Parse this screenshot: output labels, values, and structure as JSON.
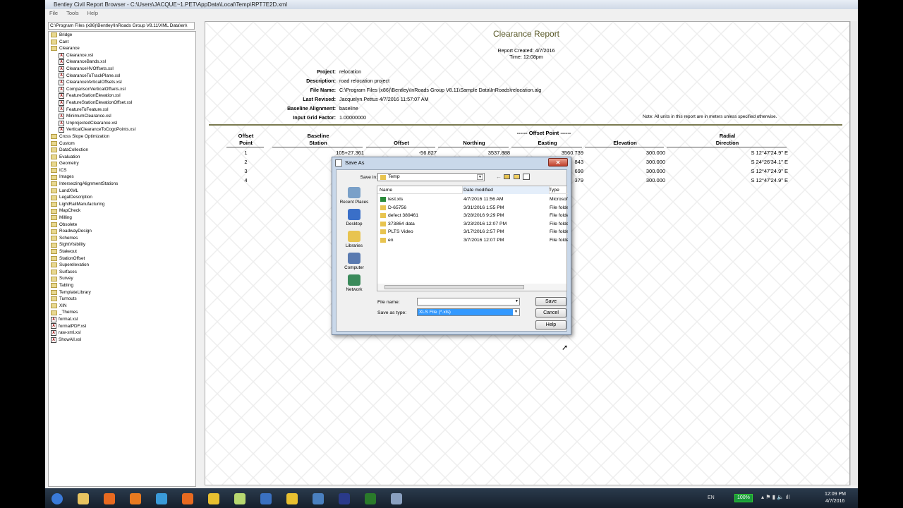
{
  "window": {
    "title": "Bentley Civil Report Browser - C:\\Users\\JACQUE~1.PET\\AppData\\Local\\Temp\\RPT7E2D.xml",
    "menu": [
      "File",
      "Tools",
      "Help"
    ]
  },
  "sidebar": {
    "path": "C:\\Program Files (x86)\\Bentley\\InRoads Group V8.11\\XML Data\\en\\",
    "items": [
      {
        "label": "Bridge",
        "type": "folder",
        "level": 0
      },
      {
        "label": "Cant",
        "type": "folder",
        "level": 0
      },
      {
        "label": "Clearance",
        "type": "folder-open",
        "level": 0
      },
      {
        "label": "Clearance.xsl",
        "type": "xsl",
        "level": 1
      },
      {
        "label": "ClearanceBands.xsl",
        "type": "xsl",
        "level": 1
      },
      {
        "label": "ClearanceHVOffsets.xsl",
        "type": "xsl",
        "level": 1
      },
      {
        "label": "ClearanceToTrackPlane.xsl",
        "type": "xsl",
        "level": 1
      },
      {
        "label": "ClearanceVerticalOffsets.xsl",
        "type": "xsl",
        "level": 1
      },
      {
        "label": "ComparisonVerticalOffsets.xsl",
        "type": "xsl",
        "level": 1
      },
      {
        "label": "FeatureStationElevation.xsl",
        "type": "xsl",
        "level": 1
      },
      {
        "label": "FeatureStationElevationOffset.xsl",
        "type": "xsl",
        "level": 1
      },
      {
        "label": "FeatureToFeature.xsl",
        "type": "xsl",
        "level": 1
      },
      {
        "label": "MinimumClearance.xsl",
        "type": "xsl",
        "level": 1
      },
      {
        "label": "UnprojectedClearance.xsl",
        "type": "xsl",
        "level": 1
      },
      {
        "label": "VerticalClearanceToCogoPoints.xsl",
        "type": "xsl",
        "level": 1
      },
      {
        "label": "Cross Slope Optimization",
        "type": "folder",
        "level": 0
      },
      {
        "label": "Custom",
        "type": "folder",
        "level": 0
      },
      {
        "label": "DataCollection",
        "type": "folder",
        "level": 0
      },
      {
        "label": "Evaluation",
        "type": "folder",
        "level": 0
      },
      {
        "label": "Geometry",
        "type": "folder",
        "level": 0
      },
      {
        "label": "ICS",
        "type": "folder",
        "level": 0
      },
      {
        "label": "Images",
        "type": "folder",
        "level": 0
      },
      {
        "label": "IntersectingAlignmentStations",
        "type": "folder",
        "level": 0
      },
      {
        "label": "LandXML",
        "type": "folder",
        "level": 0
      },
      {
        "label": "LegalDescription",
        "type": "folder",
        "level": 0
      },
      {
        "label": "LightRailManufacturing",
        "type": "folder",
        "level": 0
      },
      {
        "label": "MapCheck",
        "type": "folder",
        "level": 0
      },
      {
        "label": "Milling",
        "type": "folder",
        "level": 0
      },
      {
        "label": "Obsolete",
        "type": "folder",
        "level": 0
      },
      {
        "label": "RoadwayDesign",
        "type": "folder",
        "level": 0
      },
      {
        "label": "Schemes",
        "type": "folder",
        "level": 0
      },
      {
        "label": "SightVisibility",
        "type": "folder",
        "level": 0
      },
      {
        "label": "Stakeout",
        "type": "folder",
        "level": 0
      },
      {
        "label": "StationOffset",
        "type": "folder",
        "level": 0
      },
      {
        "label": "Superelevation",
        "type": "folder",
        "level": 0
      },
      {
        "label": "Surfaces",
        "type": "folder",
        "level": 0
      },
      {
        "label": "Survey",
        "type": "folder",
        "level": 0
      },
      {
        "label": "Tabling",
        "type": "folder",
        "level": 0
      },
      {
        "label": "TemplateLibrary",
        "type": "folder",
        "level": 0
      },
      {
        "label": "Turnouts",
        "type": "folder",
        "level": 0
      },
      {
        "label": "XIN",
        "type": "folder",
        "level": 0
      },
      {
        "label": "_Themes",
        "type": "folder",
        "level": 0
      },
      {
        "label": "format.xsl",
        "type": "xsl",
        "level": 0
      },
      {
        "label": "formatPDF.xsl",
        "type": "xsl",
        "level": 0
      },
      {
        "label": "raw-xml.xsl",
        "type": "xsl",
        "level": 0
      },
      {
        "label": "ShowAll.xsl",
        "type": "xsl",
        "level": 0
      }
    ]
  },
  "report": {
    "title": "Clearance Report",
    "created": "Report Created:  4/7/2016",
    "time": "Time:  12:08pm",
    "fields": [
      {
        "label": "Project:",
        "value": "relocation"
      },
      {
        "label": "Description:",
        "value": "road relocation project"
      },
      {
        "label": "File Name:",
        "value": "C:\\Program Files (x86)\\Bentley\\InRoads Group V8.11\\Sample Data\\InRoads\\relocation.alg"
      },
      {
        "label": "Last Revised:",
        "value": "Jacquelyn.Pettus 4/7/2016 11:57:07 AM"
      },
      {
        "label": "Baseline Alignment:",
        "value": "baseline"
      },
      {
        "label": "Input Grid Factor:",
        "value": "1.00000000"
      }
    ],
    "note": "Note:  All units in this report are in meters unless specified otherwise.",
    "group_header": "------ Offset Point ------",
    "columns": [
      {
        "l1": "Offset",
        "l2": "Point"
      },
      {
        "l1": "Baseline",
        "l2": "Station"
      },
      {
        "l1": "",
        "l2": "Offset"
      },
      {
        "l1": "",
        "l2": "Northing"
      },
      {
        "l1": "",
        "l2": "Easting"
      },
      {
        "l1": "",
        "l2": "Elevation"
      },
      {
        "l1": "Radial",
        "l2": "Direction"
      }
    ],
    "rows": [
      [
        "1",
        "105+27.361",
        "-56.827",
        "3537.888",
        "3560.739",
        "300.000",
        "S 12°47'24.9\" E"
      ],
      [
        "2",
        "",
        "",
        "",
        "843",
        "300.000",
        "S 24°26'34.1\" E"
      ],
      [
        "3",
        "",
        "",
        "",
        "698",
        "300.000",
        "S 12°47'24.9\" E"
      ],
      [
        "4",
        "",
        "",
        "",
        "379",
        "300.000",
        "S 12°47'24.9\" E"
      ]
    ]
  },
  "dialog": {
    "title": "Save As",
    "save_in_label": "Save in:",
    "save_in_value": "Temp",
    "places": [
      "Recent Places",
      "Desktop",
      "Libraries",
      "Computer",
      "Network"
    ],
    "columns": [
      "Name",
      "Date modified",
      "Type"
    ],
    "files": [
      {
        "name": "test.xls",
        "date": "4/7/2016 11:56 AM",
        "type": "Microsoft",
        "icon": "excel"
      },
      {
        "name": "D-65756",
        "date": "3/31/2016 1:55 PM",
        "type": "File folder",
        "icon": "folder"
      },
      {
        "name": "defect 389461",
        "date": "3/28/2016 9:29 PM",
        "type": "File folder",
        "icon": "folder"
      },
      {
        "name": "373864 data",
        "date": "3/23/2016 12:07 PM",
        "type": "File folder",
        "icon": "folder"
      },
      {
        "name": "PLTS Video",
        "date": "3/17/2016 2:57 PM",
        "type": "File folder",
        "icon": "folder"
      },
      {
        "name": "en",
        "date": "3/7/2016 12:07 PM",
        "type": "File folder",
        "icon": "folder"
      }
    ],
    "file_name_label": "File name:",
    "file_name_value": "",
    "save_type_label": "Save as type:",
    "save_type_value": "XLS File (*.xls)",
    "buttons": {
      "save": "Save",
      "cancel": "Cancel",
      "help": "Help"
    }
  },
  "taskbar": {
    "lang": "EN",
    "battery": "100%",
    "time": "12:09 PM",
    "date": "4/7/2016",
    "apps": [
      "windows-start",
      "file-explorer",
      "media-player",
      "outlook",
      "internet-explorer",
      "firefox",
      "chrome",
      "sticky-notes",
      "lync",
      "phone",
      "remote-desktop",
      "mathcad",
      "camtasia",
      "report-browser"
    ]
  },
  "colors": {
    "report_title": "#5a5a2a",
    "rule": "#7a7a50",
    "selection": "#3399ff"
  }
}
